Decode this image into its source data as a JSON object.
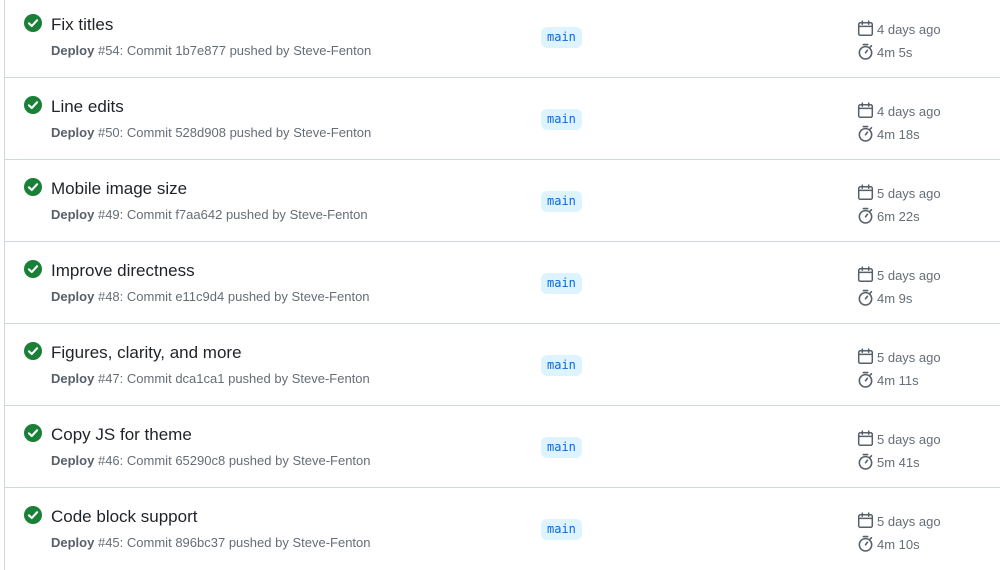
{
  "runs": [
    {
      "title": "Fix titles",
      "workflow": "Deploy",
      "run_number": "#54",
      "commit_label": "Commit",
      "commit": "1b7e877",
      "pushed_by_label": "pushed by",
      "author": "Steve-Fenton",
      "branch": "main",
      "when": "4 days ago",
      "duration": "4m 5s",
      "status": "success",
      "status_icon": "check-circle-fill-icon"
    },
    {
      "title": "Line edits",
      "workflow": "Deploy",
      "run_number": "#50",
      "commit_label": "Commit",
      "commit": "528d908",
      "pushed_by_label": "pushed by",
      "author": "Steve-Fenton",
      "branch": "main",
      "when": "4 days ago",
      "duration": "4m 18s",
      "status": "success",
      "status_icon": "check-circle-fill-icon"
    },
    {
      "title": "Mobile image size",
      "workflow": "Deploy",
      "run_number": "#49",
      "commit_label": "Commit",
      "commit": "f7aa642",
      "pushed_by_label": "pushed by",
      "author": "Steve-Fenton",
      "branch": "main",
      "when": "5 days ago",
      "duration": "6m 22s",
      "status": "success",
      "status_icon": "check-circle-fill-icon"
    },
    {
      "title": "Improve directness",
      "workflow": "Deploy",
      "run_number": "#48",
      "commit_label": "Commit",
      "commit": "e11c9d4",
      "pushed_by_label": "pushed by",
      "author": "Steve-Fenton",
      "branch": "main",
      "when": "5 days ago",
      "duration": "4m 9s",
      "status": "success",
      "status_icon": "check-circle-fill-icon"
    },
    {
      "title": "Figures, clarity, and more",
      "workflow": "Deploy",
      "run_number": "#47",
      "commit_label": "Commit",
      "commit": "dca1ca1",
      "pushed_by_label": "pushed by",
      "author": "Steve-Fenton",
      "branch": "main",
      "when": "5 days ago",
      "duration": "4m 11s",
      "status": "success",
      "status_icon": "check-circle-fill-icon"
    },
    {
      "title": "Copy JS for theme",
      "workflow": "Deploy",
      "run_number": "#46",
      "commit_label": "Commit",
      "commit": "65290c8",
      "pushed_by_label": "pushed by",
      "author": "Steve-Fenton",
      "branch": "main",
      "when": "5 days ago",
      "duration": "5m 41s",
      "status": "success",
      "status_icon": "check-circle-fill-icon"
    },
    {
      "title": "Code block support",
      "workflow": "Deploy",
      "run_number": "#45",
      "commit_label": "Commit",
      "commit": "896bc37",
      "pushed_by_label": "pushed by",
      "author": "Steve-Fenton",
      "branch": "main",
      "when": "5 days ago",
      "duration": "4m 10s",
      "status": "success",
      "status_icon": "check-circle-fill-icon"
    }
  ],
  "icons": {
    "date": "calendar-icon",
    "duration": "stopwatch-icon"
  },
  "colors": {
    "success": "#1a7f37",
    "branch_bg": "#ddf4ff",
    "branch_text": "#0969da",
    "muted": "#656d76",
    "border": "#d0d7de"
  }
}
